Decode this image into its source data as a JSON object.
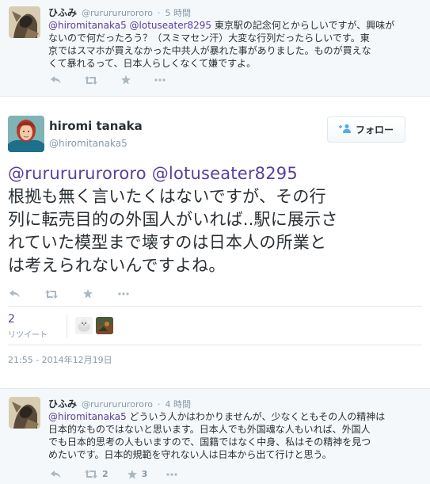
{
  "top_tweet": {
    "name": "ひふみ",
    "handle": "@rururururororo",
    "time": "5 時間",
    "mentions": "@hiromitanaka5 @lotuseater8295",
    "line1_rest": " 東京駅の記念何とからしいですが、興味が",
    "line2": "ないので何だったろう？（スミマセン汗）大変な行列だったらしいです。東",
    "line3": "京ではスマホが買えなかった中共人が暴れた事がありました。ものが買えな",
    "line4": "くて暴れるって、日本人らしくなくて嫌ですよ。"
  },
  "main_tweet": {
    "name": "hiromi tanaka",
    "handle": "@hiromitanaka5",
    "follow_label": "フォロー",
    "mention1": "@rururururororo",
    "mention2": "@lotuseater8295",
    "line1": "根拠も無く言いたくはないですが、その行",
    "line2": "列に転売目的の外国人がいれば..駅に展示さ",
    "line3": "れていた模型まで壊すのは日本人の所業と",
    "line4": "は考えられないんですよね。",
    "retweet_count": "2",
    "retweet_label": "リツイート",
    "timestamp": "21:55 - 2014年12月19日"
  },
  "bottom_tweet": {
    "name": "ひふみ",
    "handle": "@rururururororo",
    "time": "4 時間",
    "mention": "@hiromitanaka5",
    "line1_rest": " どういう人かはわかりませんが、少なくともその人の精神は",
    "line2": "日本的なものではないと思います。日本人でも外国魂な人もいれば、外国人",
    "line3": "でも日本的思考の人もいますので、国籍ではなく中身、私はその精神を見つ",
    "line4": "めたいです。日本的規範を守れない人は日本から出て行けと思う。",
    "retweet_count": "2",
    "favorite_count": "3"
  },
  "colors": {
    "mention": "#5a3e9b",
    "action_icon": "#aab8c2",
    "meta": "#8899a6"
  },
  "icons": [
    "reply-icon",
    "retweet-icon",
    "favorite-icon",
    "more-icon",
    "follow-person-icon"
  ]
}
